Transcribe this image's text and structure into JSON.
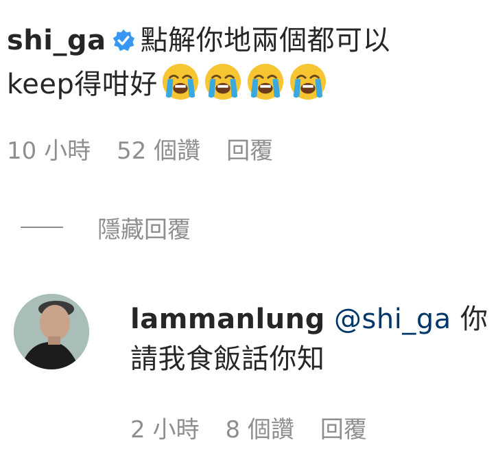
{
  "comment": {
    "username": "shi_ga",
    "text_line1": "點解你地兩個都可以",
    "text_line2": "keep得咁好",
    "emoji_icon": "loudly-crying-face-icon",
    "emoji_count": 4,
    "time": "10 小時",
    "likes": "52 個讚",
    "reply_label": "回覆"
  },
  "hide_replies_label": "隱藏回覆",
  "reply": {
    "username": "lammanlung",
    "mention": "@shi_ga",
    "text_inline": "你",
    "text_line2": "請我食飯話你知",
    "time": "2 小時",
    "likes": "8 個讚",
    "reply_label": "回覆"
  },
  "colors": {
    "text": "#262626",
    "muted": "#8e8e8e",
    "verified": "#3897f0",
    "mention": "#00376b"
  }
}
